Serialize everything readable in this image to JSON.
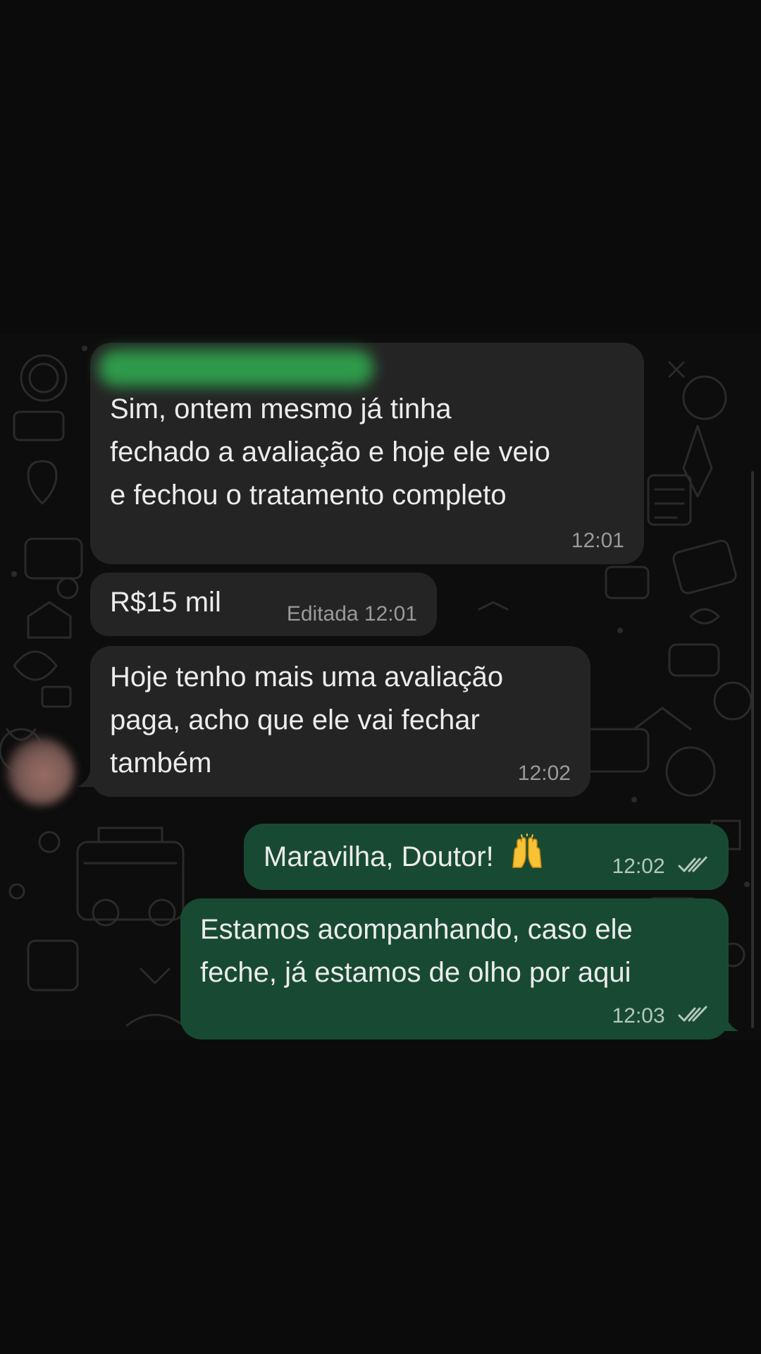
{
  "chat": {
    "messages": [
      {
        "direction": "incoming",
        "text": "Sim, ontem mesmo já tinha fechado a avaliação e hoje ele veio e fechou o tratamento completo",
        "lines": [
          "Sim, ontem mesmo já tinha",
          "fechado a avaliação e hoje ele veio",
          "e fechou o tratamento completo"
        ],
        "time": "12:01"
      },
      {
        "direction": "incoming",
        "text": "R$15 mil",
        "edited_label": "Editada",
        "time": "12:01"
      },
      {
        "direction": "incoming",
        "text": "Hoje tenho mais uma avaliação paga, acho que ele vai fechar também",
        "lines": [
          "Hoje tenho mais uma avaliação",
          "paga, acho que ele vai fechar",
          "também"
        ],
        "time": "12:02"
      },
      {
        "direction": "outgoing",
        "text": "Maravilha, Doutor!",
        "emoji": "raising-hands",
        "time": "12:02",
        "status": "read"
      },
      {
        "direction": "outgoing",
        "text": "Estamos acompanhando, caso ele feche, já estamos de olho por aqui",
        "lines": [
          "Estamos acompanhando, caso ele",
          "feche, já estamos de olho por aqui"
        ],
        "time": "12:03",
        "status": "read"
      }
    ]
  },
  "colors": {
    "background": "#0b0b0b",
    "incoming_bubble": "#242424",
    "outgoing_bubble": "#184a33",
    "text": "#ececec",
    "meta_text": "#9a9a9a"
  }
}
